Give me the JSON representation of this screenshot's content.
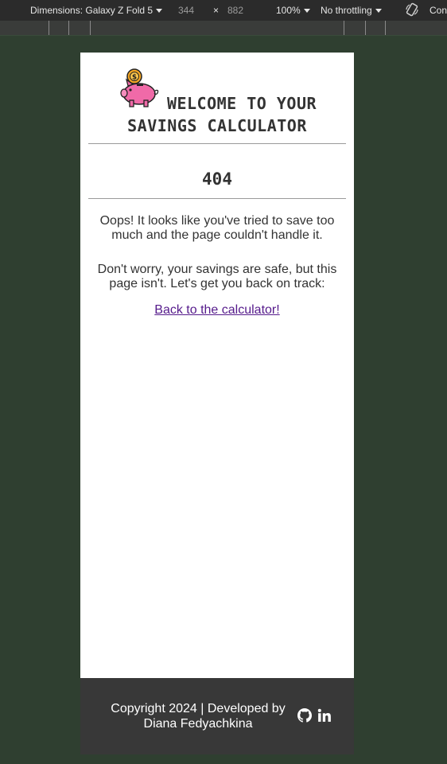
{
  "devtools": {
    "dimensions_label": "Dimensions: Galaxy Z Fold 5",
    "width": "344",
    "times": "×",
    "height": "882",
    "zoom": "100%",
    "throttling": "No throttling",
    "cutoff_label": "Con"
  },
  "header": {
    "icon": "piggy-bank-with-coin",
    "title_line1": "WELCOME TO YOUR",
    "title_line2": "SAVINGS CALCULATOR"
  },
  "error": {
    "code": "404",
    "message1": "Oops! It looks like you've tried to save too much and the page couldn't handle it.",
    "message2": "Don't worry, your savings are safe, but this page isn't. Let's get you back on track:",
    "back_link": "Back to the calculator!"
  },
  "footer": {
    "copyright": "Copyright 2024 | Developed by Diana Fedyachkina",
    "icons": [
      "github-icon",
      "linkedin-icon"
    ]
  },
  "colors": {
    "page_bg": "#2f3f30",
    "footer_bg": "#383838",
    "link": "#551a8b",
    "text": "#333333"
  }
}
